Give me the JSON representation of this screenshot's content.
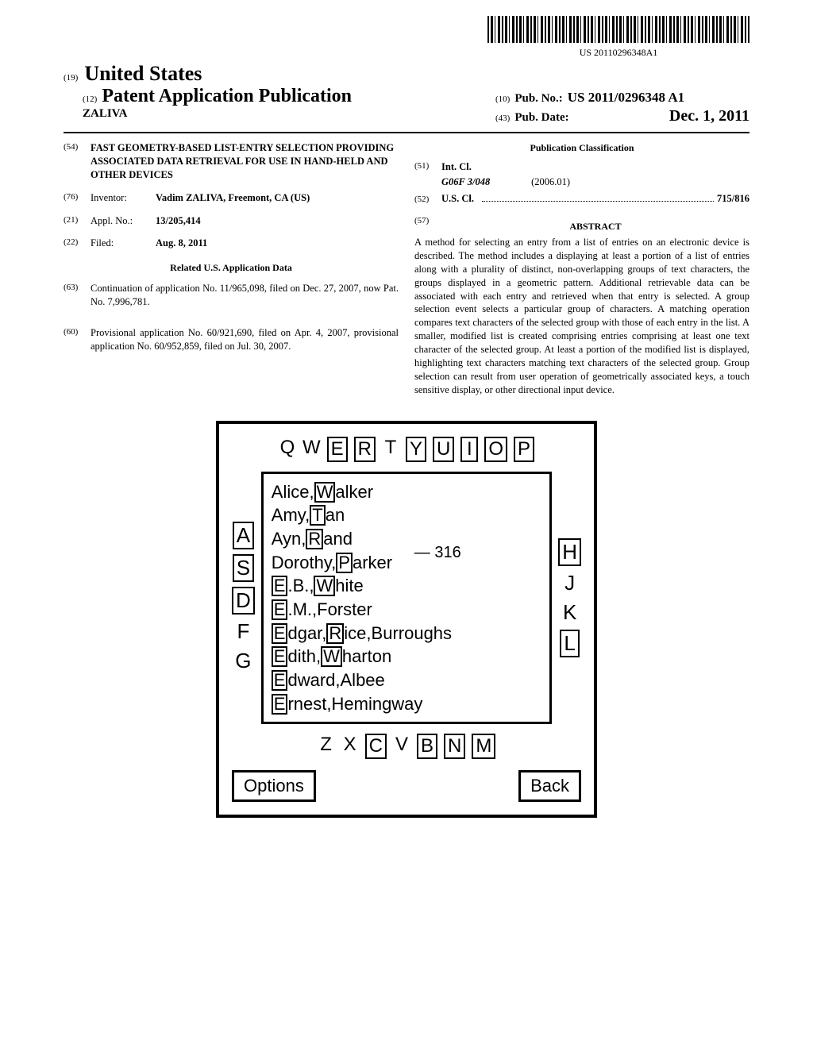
{
  "barcode_number": "US 20110296348A1",
  "country_code": "(19)",
  "country": "United States",
  "pub_type_code": "(12)",
  "pub_type": "Patent Application Publication",
  "inventor_header": "ZALIVA",
  "pub_no_code": "(10)",
  "pub_no_label": "Pub. No.:",
  "pub_no": "US 2011/0296348 A1",
  "pub_date_code": "(43)",
  "pub_date_label": "Pub. Date:",
  "pub_date": "Dec. 1, 2011",
  "title_code": "(54)",
  "title": "FAST GEOMETRY-BASED LIST-ENTRY SELECTION PROVIDING ASSOCIATED DATA RETRIEVAL FOR USE IN HAND-HELD AND OTHER DEVICES",
  "inventor_code": "(76)",
  "inventor_label": "Inventor:",
  "inventor": "Vadim ZALIVA, Freemont, CA (US)",
  "appl_code": "(21)",
  "appl_label": "Appl. No.:",
  "appl_no": "13/205,414",
  "filed_code": "(22)",
  "filed_label": "Filed:",
  "filed": "Aug. 8, 2011",
  "related_title": "Related U.S. Application Data",
  "cont_code": "(63)",
  "cont_text": "Continuation of application No. 11/965,098, filed on Dec. 27, 2007, now Pat. No. 7,996,781.",
  "prov_code": "(60)",
  "prov_text": "Provisional application No. 60/921,690, filed on Apr. 4, 2007, provisional application No. 60/952,859, filed on Jul. 30, 2007.",
  "pub_class_title": "Publication Classification",
  "intcl_code": "(51)",
  "intcl_label": "Int. Cl.",
  "intcl_class": "G06F 3/048",
  "intcl_date": "(2006.01)",
  "uscl_code": "(52)",
  "uscl_label": "U.S. Cl.",
  "uscl_val": "715/816",
  "abstract_code": "(57)",
  "abstract_label": "ABSTRACT",
  "abstract_text": "A method for selecting an entry from a list of entries on an electronic device is described. The method includes a displaying at least a portion of a list of entries along with a plurality of distinct, non-overlapping groups of text characters, the groups displayed in a geometric pattern. Additional retrievable data can be associated with each entry and retrieved when that entry is selected. A group selection event selects a particular group of characters. A matching operation compares text characters of the selected group with those of each entry in the list. A smaller, modified list is created comprising entries comprising at least one text character of the selected group. At least a portion of the modified list is displayed, highlighting text characters matching text characters of the selected group. Group selection can result from user operation of geometrically associated keys, a touch sensitive display, or other directional input device.",
  "figure": {
    "top_keys": [
      {
        "ch": "Q",
        "boxed": false
      },
      {
        "ch": "W",
        "boxed": false
      },
      {
        "ch": "E",
        "boxed": true
      },
      {
        "ch": "R",
        "boxed": true
      },
      {
        "ch": "T",
        "boxed": false
      },
      {
        "ch": "Y",
        "boxed": true
      },
      {
        "ch": "U",
        "boxed": true
      },
      {
        "ch": "I",
        "boxed": true
      },
      {
        "ch": "O",
        "boxed": true
      },
      {
        "ch": "P",
        "boxed": true
      }
    ],
    "left_keys": [
      {
        "ch": "A",
        "boxed": true
      },
      {
        "ch": "S",
        "boxed": true
      },
      {
        "ch": "D",
        "boxed": true
      },
      {
        "ch": "F",
        "boxed": false
      },
      {
        "ch": "G",
        "boxed": false
      }
    ],
    "right_keys": [
      {
        "ch": "H",
        "boxed": true
      },
      {
        "ch": "J",
        "boxed": false
      },
      {
        "ch": "K",
        "boxed": false
      },
      {
        "ch": "L",
        "boxed": true
      }
    ],
    "bottom_keys": [
      {
        "ch": "Z",
        "boxed": false
      },
      {
        "ch": "X",
        "boxed": false
      },
      {
        "ch": "C",
        "boxed": true
      },
      {
        "ch": "V",
        "boxed": false
      },
      {
        "ch": "B",
        "boxed": true
      },
      {
        "ch": "N",
        "boxed": true
      },
      {
        "ch": "M",
        "boxed": true
      }
    ],
    "ref_num": "316",
    "entries": [
      {
        "parts": [
          {
            "t": "Alice,",
            "h": false
          },
          {
            "t": "W",
            "h": true
          },
          {
            "t": "alker",
            "h": false
          }
        ]
      },
      {
        "parts": [
          {
            "t": "Amy,",
            "h": false
          },
          {
            "t": "T",
            "h": true
          },
          {
            "t": "an",
            "h": false
          }
        ]
      },
      {
        "parts": [
          {
            "t": "Ayn,",
            "h": false
          },
          {
            "t": "R",
            "h": true
          },
          {
            "t": "and",
            "h": false
          }
        ]
      },
      {
        "parts": [
          {
            "t": "Dorothy,",
            "h": false
          },
          {
            "t": "P",
            "h": true
          },
          {
            "t": "arker",
            "h": false
          }
        ]
      },
      {
        "parts": [
          {
            "t": "E",
            "h": true
          },
          {
            "t": ".B.,",
            "h": false
          },
          {
            "t": "W",
            "h": true
          },
          {
            "t": "hite",
            "h": false
          }
        ]
      },
      {
        "parts": [
          {
            "t": "E",
            "h": true
          },
          {
            "t": ".M.,Forster",
            "h": false
          }
        ]
      },
      {
        "parts": [
          {
            "t": "E",
            "h": true
          },
          {
            "t": "dgar,",
            "h": false
          },
          {
            "t": "R",
            "h": true
          },
          {
            "t": "ice,Burroughs",
            "h": false
          }
        ]
      },
      {
        "parts": [
          {
            "t": "E",
            "h": true
          },
          {
            "t": "dith,",
            "h": false
          },
          {
            "t": "W",
            "h": true
          },
          {
            "t": "harton",
            "h": false
          }
        ]
      },
      {
        "parts": [
          {
            "t": "E",
            "h": true
          },
          {
            "t": "dward,Albee",
            "h": false
          }
        ]
      },
      {
        "parts": [
          {
            "t": "E",
            "h": true
          },
          {
            "t": "rnest,Hemingway",
            "h": false
          }
        ]
      }
    ],
    "options_btn": "Options",
    "back_btn": "Back"
  }
}
